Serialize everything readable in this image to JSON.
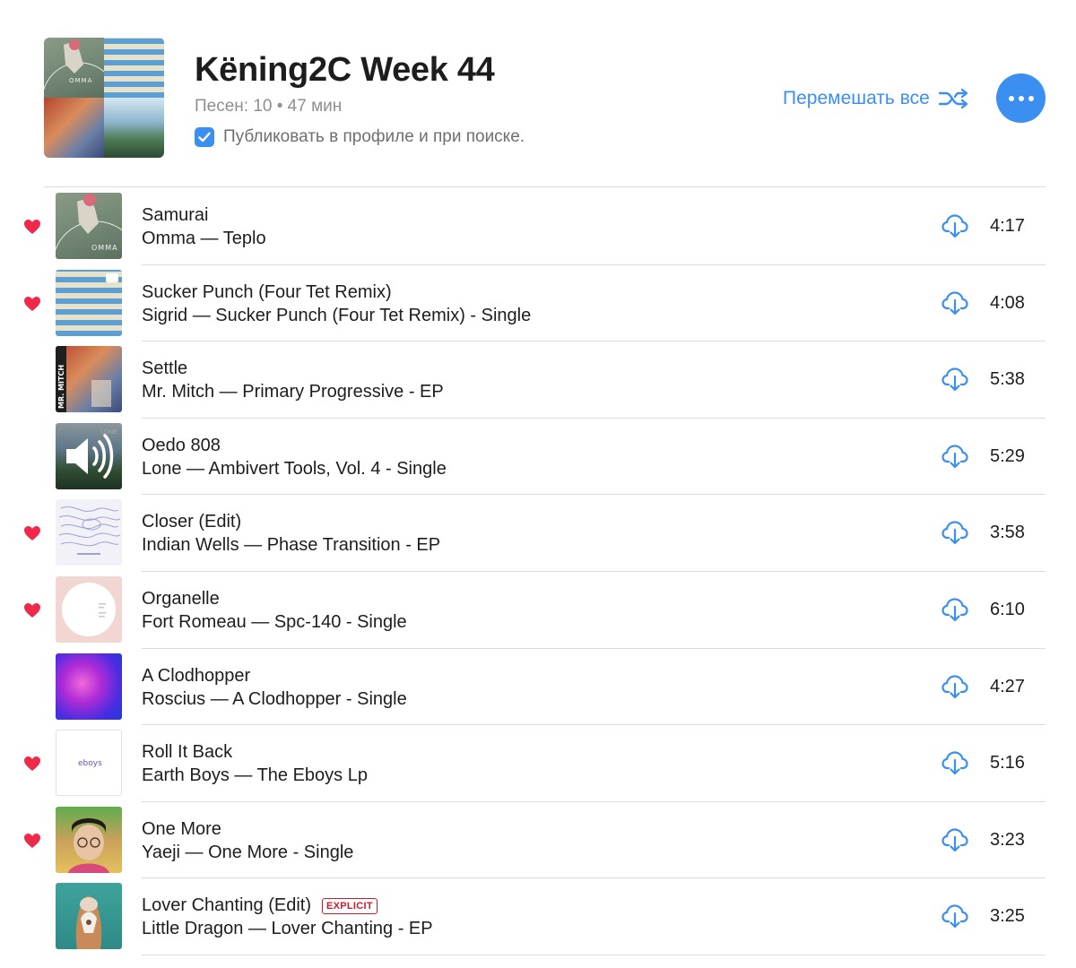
{
  "playlist": {
    "title": "Këning2C Week 44",
    "meta": "Песен: 10 • 47 мин",
    "publish_label": "Публиковать в профиле и при поиске.",
    "publish_checked": true,
    "shuffle_label": "Перемешать все",
    "more_icon": "ellipsis-icon"
  },
  "colors": {
    "accent": "#3b8ff1",
    "heart": "#f0284a",
    "explicit": "#c4202e",
    "divider": "#dcdcdc"
  },
  "tracks": [
    {
      "title": "Samurai",
      "subtitle": "Omma — Teplo",
      "duration": "4:17",
      "loved": true,
      "explicit": false,
      "playing": false
    },
    {
      "title": "Sucker Punch (Four Tet Remix)",
      "subtitle": "Sigrid — Sucker Punch (Four Tet Remix) - Single",
      "duration": "4:08",
      "loved": true,
      "explicit": false,
      "playing": false
    },
    {
      "title": "Settle",
      "subtitle": "Mr. Mitch — Primary Progressive - EP",
      "duration": "5:38",
      "loved": false,
      "explicit": false,
      "playing": false
    },
    {
      "title": "Oedo 808",
      "subtitle": "Lone — Ambivert Tools, Vol. 4 - Single",
      "duration": "5:29",
      "loved": false,
      "explicit": false,
      "playing": true
    },
    {
      "title": "Closer (Edit)",
      "subtitle": "Indian Wells — Phase Transition - EP",
      "duration": "3:58",
      "loved": true,
      "explicit": false,
      "playing": false
    },
    {
      "title": "Organelle",
      "subtitle": "Fort Romeau — Spc-140 - Single",
      "duration": "6:10",
      "loved": true,
      "explicit": false,
      "playing": false
    },
    {
      "title": "A Clodhopper",
      "subtitle": "Roscius — A Clodhopper - Single",
      "duration": "4:27",
      "loved": false,
      "explicit": false,
      "playing": false
    },
    {
      "title": "Roll It Back",
      "subtitle": "Earth Boys — The Eboys Lp",
      "duration": "5:16",
      "loved": true,
      "explicit": false,
      "playing": false
    },
    {
      "title": "One More",
      "subtitle": "Yaeji — One More - Single",
      "duration": "3:23",
      "loved": true,
      "explicit": false,
      "playing": false
    },
    {
      "title": "Lover Chanting (Edit)",
      "subtitle": "Little Dragon — Lover Chanting - EP",
      "duration": "3:25",
      "loved": false,
      "explicit": true,
      "explicit_label": "EXPLICIT",
      "playing": false
    }
  ],
  "artwork": {
    "omma_text": "OMMA",
    "mitch_text": "MR. MITCH",
    "lone_text": "LONE",
    "eboys_text": "eboys"
  }
}
